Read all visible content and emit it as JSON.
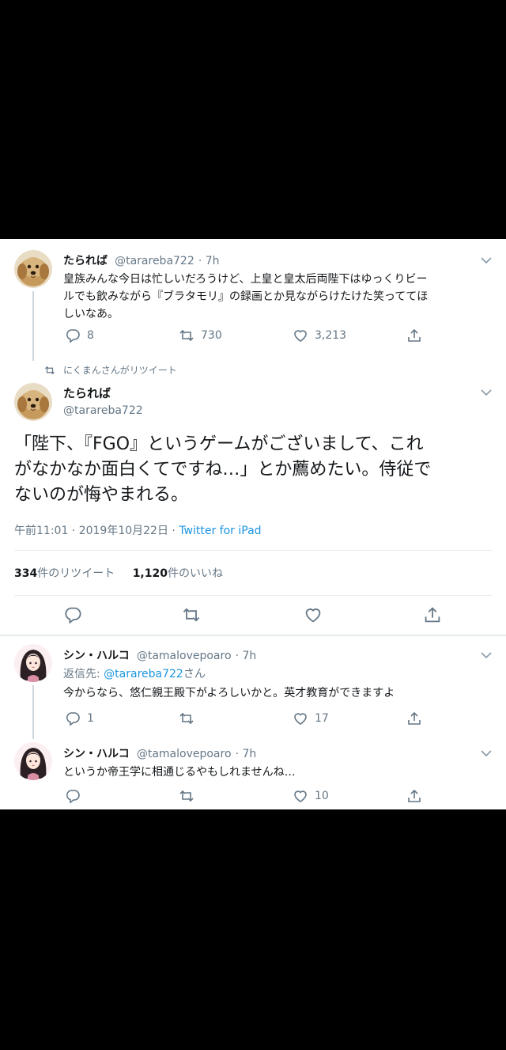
{
  "tweet1": {
    "name": "たられば",
    "handle": "@tarareba722",
    "time": "7h",
    "text_lines": [
      "皇族みんな今日は忙しいだろうけど、上皇と皇太后両陛下はゆっくりビー",
      "ルでも飲みながら『ブラタモリ』の録画とか見ながらけたけた笑っててほ",
      "しいなあ。"
    ],
    "replies": "8",
    "retweets": "730",
    "likes": "3,213"
  },
  "retweet_context": "にくまんさんがリツイート",
  "main_tweet": {
    "name": "たられば",
    "handle": "@tarareba722",
    "text_lines": [
      "「陛下、『FGO』というゲームがございまして、これ",
      "がなかなか面白くてですね…」とか薦めたい。侍従で",
      "ないのが悔やまれる。"
    ],
    "timestamp": "午前11:01 · 2019年10月22日 · ",
    "source": "Twitter for iPad",
    "retweet_count": "334",
    "retweet_label": "件のリツイート",
    "like_count": "1,120",
    "like_label": "件のいいね"
  },
  "reply1": {
    "name": "シン・ハルコ",
    "handle": "@tamalovepoaro",
    "time": "7h",
    "reply_prefix": "返信先: ",
    "reply_to": "@tarareba722",
    "reply_suffix": "さん",
    "text": "今からなら、悠仁親王殿下がよろしいかと。英才教育ができますよ",
    "replies": "1",
    "retweets": "",
    "likes": "17"
  },
  "reply2": {
    "name": "シン・ハルコ",
    "handle": "@tamalovepoaro",
    "time": "7h",
    "text": "というか帝王学に相通じるやもしれませんね…",
    "replies": "",
    "retweets": "",
    "likes": "10"
  },
  "colors": {
    "accent": "#1b95e0",
    "muted": "#657786",
    "text": "#14171a",
    "background": "#000000"
  }
}
